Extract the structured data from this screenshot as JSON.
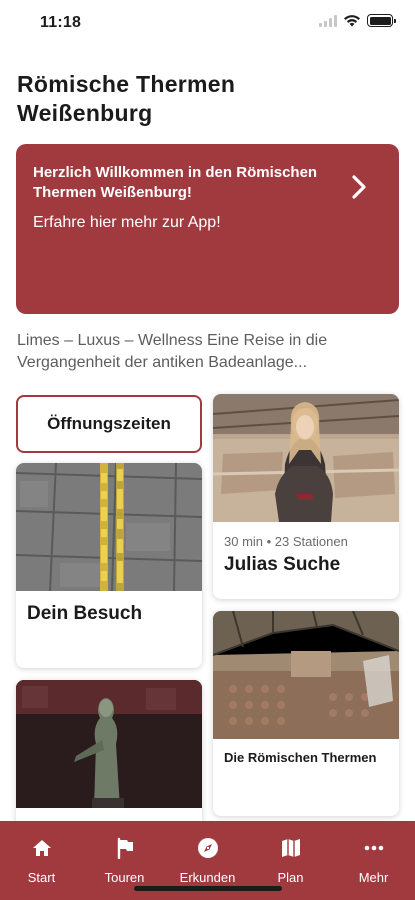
{
  "status_bar": {
    "time": "11:18"
  },
  "header": {
    "title": "Römische Thermen Weißenburg"
  },
  "welcome_banner": {
    "title": "Herzlich Willkommen in den Römischen Thermen Weißenburg!",
    "subtitle": "Erfahre hier mehr zur App!"
  },
  "intro_text": "Limes – Luxus – Wellness Eine Reise in die Vergangenheit der antiken Badeanlage...",
  "opening_hours_button": "Öffnungszeiten",
  "cards": {
    "tour": {
      "meta": "30 min • 23 Stationen",
      "title": "Julias Suche"
    },
    "visit": {
      "title": "Dein Besuch"
    },
    "thermen": {
      "title": "Die Römischen Thermen"
    }
  },
  "tabs": [
    {
      "label": "Start",
      "icon": "home-icon"
    },
    {
      "label": "Touren",
      "icon": "flag-icon"
    },
    {
      "label": "Erkunden",
      "icon": "compass-icon"
    },
    {
      "label": "Plan",
      "icon": "map-icon"
    },
    {
      "label": "Mehr",
      "icon": "more-icon"
    }
  ],
  "colors": {
    "accent": "#a13a3f",
    "text": "#1b1b1b",
    "muted": "#5d5d5d"
  }
}
